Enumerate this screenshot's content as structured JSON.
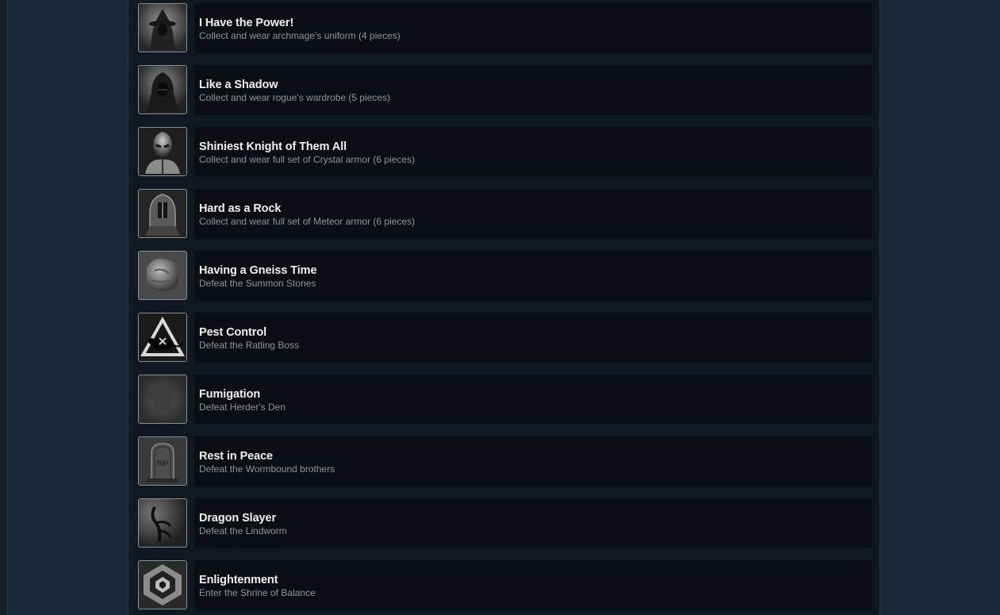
{
  "achievements": [
    {
      "title": "I Have the Power!",
      "description": "Collect and wear archmage's uniform (4 pieces)",
      "icon": "wizard-hat-icon"
    },
    {
      "title": "Like a Shadow",
      "description": "Collect and wear rogue's wardrobe (5 pieces)",
      "icon": "hooded-rogue-icon"
    },
    {
      "title": "Shiniest Knight of Them All",
      "description": "Collect and wear full set of Crystal armor (6 pieces)",
      "icon": "crystal-knight-icon"
    },
    {
      "title": "Hard as a Rock",
      "description": "Collect and wear full set of Meteor armor (6 pieces)",
      "icon": "meteor-helmet-icon"
    },
    {
      "title": "Having a Gneiss Time",
      "description": "Defeat the Summon Stones",
      "icon": "stone-golem-icon"
    },
    {
      "title": "Pest Control",
      "description": "Defeat the Ratling Boss",
      "icon": "rat-warning-icon"
    },
    {
      "title": "Fumigation",
      "description": "Defeat Herder's Den",
      "icon": "smoke-cloud-icon"
    },
    {
      "title": "Rest in Peace",
      "description": "Defeat the Wormbound brothers",
      "icon": "tombstone-icon",
      "icon_text": "RIP"
    },
    {
      "title": "Dragon Slayer",
      "description": "Defeat the Lindworm",
      "icon": "dragon-claw-icon"
    },
    {
      "title": "Enlightenment",
      "description": "Enter the Shrine of Balance",
      "icon": "shrine-crystal-icon"
    }
  ]
}
